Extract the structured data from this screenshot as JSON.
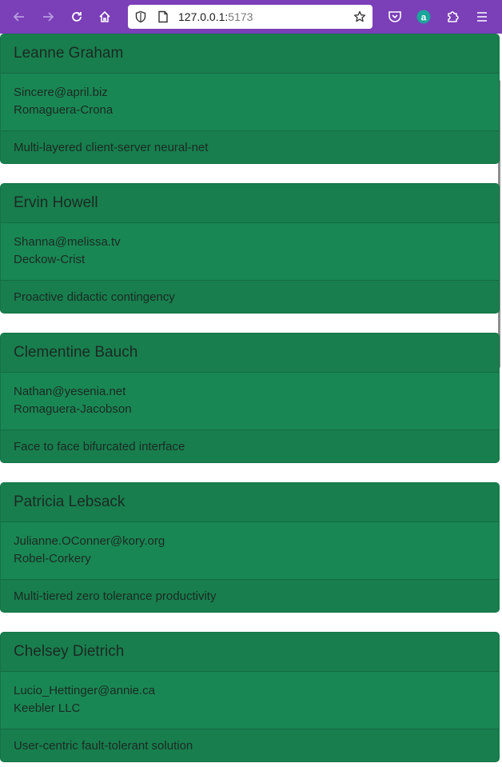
{
  "browser": {
    "url_host": "127.0.0.1:",
    "url_port": "5173",
    "toolbar_color": "#7b3fb8"
  },
  "users": [
    {
      "name": "Leanne Graham",
      "email": "Sincere@april.biz",
      "company": "Romaguera-Crona",
      "catchphrase": "Multi-layered client-server neural-net"
    },
    {
      "name": "Ervin Howell",
      "email": "Shanna@melissa.tv",
      "company": "Deckow-Crist",
      "catchphrase": "Proactive didactic contingency"
    },
    {
      "name": "Clementine Bauch",
      "email": "Nathan@yesenia.net",
      "company": "Romaguera-Jacobson",
      "catchphrase": "Face to face bifurcated interface"
    },
    {
      "name": "Patricia Lebsack",
      "email": "Julianne.OConner@kory.org",
      "company": "Robel-Corkery",
      "catchphrase": "Multi-tiered zero tolerance productivity"
    },
    {
      "name": "Chelsey Dietrich",
      "email": "Lucio_Hettinger@annie.ca",
      "company": "Keebler LLC",
      "catchphrase": "User-centric fault-tolerant solution"
    }
  ],
  "theme": {
    "card_color": "#198754"
  }
}
